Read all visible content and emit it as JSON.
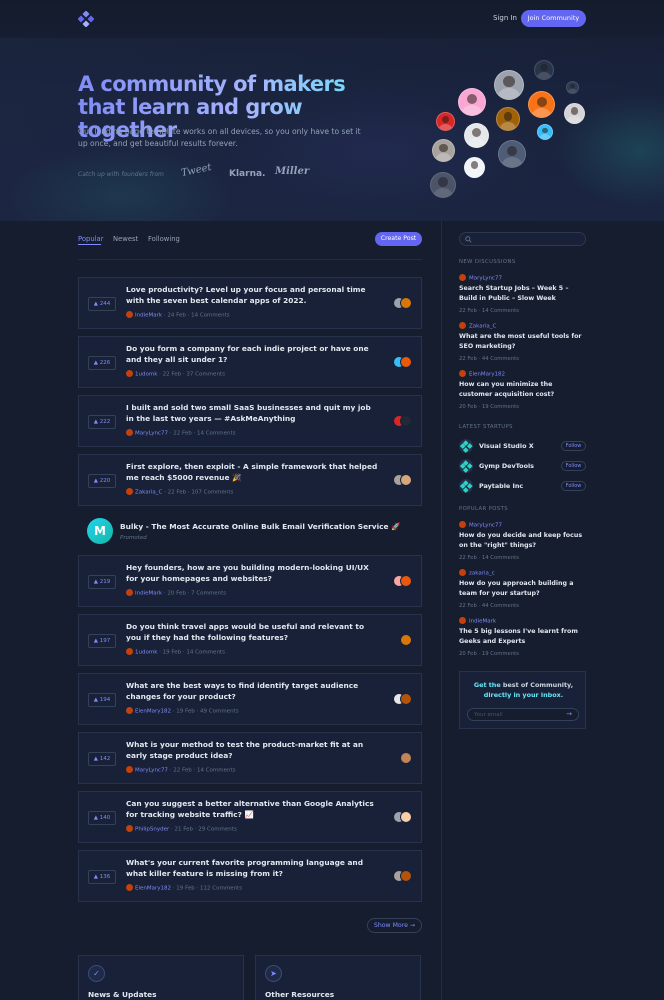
{
  "header": {
    "logo_icon": "community-logo-icon",
    "sign_in": "Sign In",
    "join": "Join Community"
  },
  "hero": {
    "title": "A community of makers that learn and grow together",
    "subtitle": "Our landing page template works on all devices, so you only have to set it up once, and get beautiful results forever.",
    "founders_label": "Catch up with founders from",
    "brands": [
      "Tweet",
      "Klarna.",
      "Miller"
    ]
  },
  "feed": {
    "tabs": [
      "Popular",
      "Newest",
      "Following"
    ],
    "active_tab": "Popular",
    "create_post": "Create Post",
    "posts": [
      {
        "votes": "244",
        "title": "Love productivity? Level up your focus and personal time with the seven best calendar apps of 2022.",
        "author": "IndieMark",
        "date": "24 Feb",
        "comments": "14 Comments"
      },
      {
        "votes": "226",
        "title": "Do you form a company for each indie project or have one and they all sit under 1?",
        "author": "1udomk",
        "date": "22 Feb",
        "comments": "37 Comments"
      },
      {
        "votes": "222",
        "title": "I built and sold two small SaaS businesses and quit my job in the last two years — #AskMeAnything",
        "author": "MaryLync77",
        "date": "22 Feb",
        "comments": "14 Comments"
      },
      {
        "votes": "220",
        "title": "First explore, then exploit - A simple framework that helped me reach $5000 revenue 🎉",
        "author": "Zakaria_C",
        "date": "22 Feb",
        "comments": "107 Comments"
      },
      {
        "votes": "219",
        "title": "Hey founders, how are you building modern-looking UI/UX for your homepages and websites?",
        "author": "IndieMark",
        "date": "20 Feb",
        "comments": "7 Comments"
      },
      {
        "votes": "197",
        "title": "Do you think travel apps would be useful and relevant to you if they had the following features?",
        "author": "1udomk",
        "date": "19 Feb",
        "comments": "14 Comments"
      },
      {
        "votes": "194",
        "title": "What are the best ways to find identify target audience changes for your product?",
        "author": "ElenMary182",
        "date": "19 Feb",
        "comments": "49 Comments"
      },
      {
        "votes": "142",
        "title": "What is your method to test the product-market fit at an early stage product idea?",
        "author": "MaryLync77",
        "date": "22 Feb",
        "comments": "14 Comments"
      },
      {
        "votes": "140",
        "title": "Can you suggest a better alternative than Google Analytics for tracking website traffic? 📈",
        "author": "PhilipSnyder",
        "date": "21 Feb",
        "comments": "29 Comments"
      },
      {
        "votes": "136",
        "title": "What's your current favorite programming language and what killer feature is missing from it?",
        "author": "ElenMary182",
        "date": "19 Feb",
        "comments": "112 Comments"
      }
    ],
    "promo": {
      "logo_letter": "M",
      "title": "Bulky - The Most Accurate Online Bulk Email Verification Service 🚀",
      "label": "Promoted"
    },
    "show_more": "Show More →"
  },
  "bottom_cards": [
    {
      "title": "News & Updates",
      "icon": "check-icon"
    },
    {
      "title": "Other Resources",
      "icon": "cursor-icon"
    }
  ],
  "sidebar": {
    "search_placeholder": "",
    "new_discussions_heading": "New Discussions",
    "discussions": [
      {
        "author": "MaryLync77",
        "title": "Search Startup Jobs – Week 5 – Build in Public – Slow Week",
        "date": "22 Feb",
        "comments": "14 Comments"
      },
      {
        "author": "Zakaria_C",
        "title": "What are the most useful tools for SEO marketing?",
        "date": "22 Feb",
        "comments": "44 Comments"
      },
      {
        "author": "ElenMary182",
        "title": "How can you minimize the customer acquisition cost?",
        "date": "20 Feb",
        "comments": "19 Comments"
      }
    ],
    "latest_startups_heading": "Latest Startups",
    "startups": [
      {
        "name": "Visual Studio X",
        "follow": "Follow"
      },
      {
        "name": "Gymp DevTools",
        "follow": "Follow"
      },
      {
        "name": "Paytable Inc",
        "follow": "Follow"
      }
    ],
    "popular_posts_heading": "Popular Posts",
    "popular": [
      {
        "author": "MaryLync77",
        "title": "How do you decide and keep focus on the \"right\" things?",
        "date": "22 Feb",
        "comments": "14 Comments"
      },
      {
        "author": "zakaria_c",
        "title": "How do you approach building a team for your startup?",
        "date": "22 Feb",
        "comments": "44 Comments"
      },
      {
        "author": "IndieMark",
        "title": "The 5 big lessons I've learnt from Geeks and Experts",
        "date": "20 Feb",
        "comments": "19 Comments"
      }
    ],
    "newsletter": {
      "line1_pre": "Get the ",
      "line1_hl": "best of Community,",
      "line2": "directly in your inbox.",
      "placeholder": "Your email",
      "submit_icon": "arrow-right-icon"
    }
  }
}
